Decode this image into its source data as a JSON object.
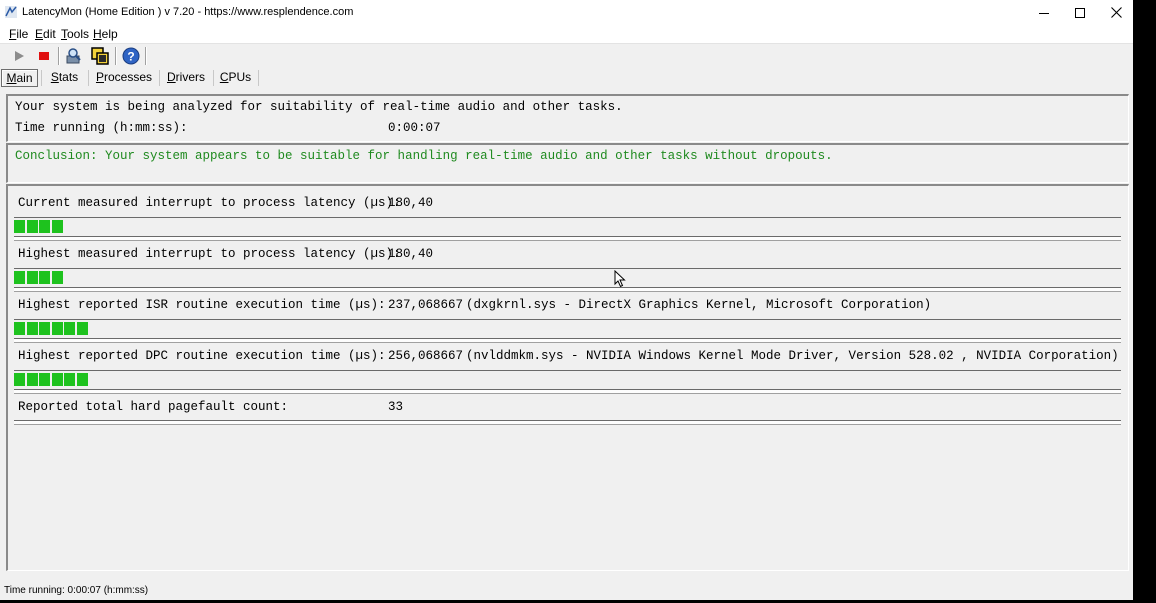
{
  "window": {
    "title": "LatencyMon  (Home Edition )  v 7.20 - https://www.resplendence.com"
  },
  "menu": [
    "File",
    "Edit",
    "Tools",
    "Help"
  ],
  "toolbar": {
    "icons": [
      "play-icon",
      "stop-icon",
      "inspect-icon",
      "cpu-icon",
      "help-icon"
    ]
  },
  "tabs": [
    "Main",
    "Stats",
    "Processes",
    "Drivers",
    "CPUs"
  ],
  "active_tab": "Main",
  "analysis": {
    "line1": "Your system is being analyzed for suitability of real-time audio and other tasks.",
    "time_label": "Time running (h:mm:ss):",
    "time_value": "0:00:07"
  },
  "conclusion": "Conclusion: Your system appears to be suitable for handling real-time audio and other tasks without dropouts.",
  "metrics": [
    {
      "label": "Current measured interrupt to process latency (µs):",
      "value": "180,40",
      "detail": "",
      "bar_segments": 4
    },
    {
      "label": "Highest measured interrupt to process latency (µs):",
      "value": "180,40",
      "detail": "",
      "bar_segments": 4
    },
    {
      "label": "Highest reported ISR routine execution time (µs):",
      "value": "237,068667",
      "detail": "(dxgkrnl.sys - DirectX Graphics Kernel, Microsoft Corporation)",
      "bar_segments": 6
    },
    {
      "label": "Highest reported DPC routine execution time (µs):",
      "value": "256,068667",
      "detail": "(nvlddmkm.sys - NVIDIA Windows Kernel Mode Driver, Version 528.02 , NVIDIA Corporation)",
      "bar_segments": 6
    },
    {
      "label": "Reported total hard pagefault count:",
      "value": "33",
      "detail": ""
    }
  ],
  "status_bar": "Time running: 0:00:07  (h:mm:ss)",
  "colors": {
    "conclusion_green": "#1f8a1f",
    "bar_green": "#1ec21e"
  }
}
